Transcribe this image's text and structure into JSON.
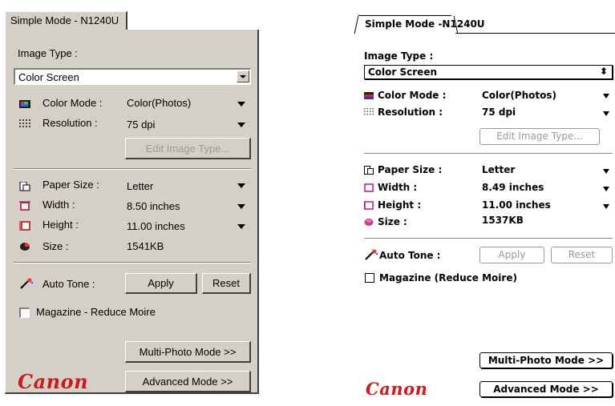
{
  "windows": {
    "tab": "Simple Mode - N1240U",
    "image_type_label": "Image Type :",
    "image_type_value": "Color Screen",
    "color_mode_label": "Color Mode :",
    "color_mode_value": "Color(Photos)",
    "resolution_label": "Resolution :",
    "resolution_value": "75 dpi",
    "edit_image_type": "Edit Image Type...",
    "paper_size_label": "Paper Size :",
    "paper_size_value": "Letter",
    "width_label": "Width :",
    "width_value": "8.50 inches",
    "height_label": "Height :",
    "height_value": "11.00 inches",
    "size_label": "Size :",
    "size_value": "1541KB",
    "auto_tone_label": "Auto Tone :",
    "apply": "Apply",
    "reset": "Reset",
    "magazine": "Magazine - Reduce Moire",
    "multi_photo": "Multi-Photo Mode >>",
    "advanced": "Advanced Mode >>",
    "logo": "Canon"
  },
  "mac": {
    "tab": "Simple Mode -N1240U",
    "image_type_label": "Image Type :",
    "image_type_value": "Color Screen",
    "color_mode_label": "Color Mode :",
    "color_mode_value": "Color(Photos)",
    "resolution_label": "Resolution :",
    "resolution_value": "75 dpi",
    "edit_image_type": "Edit Image Type...",
    "paper_size_label": "Paper Size :",
    "paper_size_value": "Letter",
    "width_label": "Width :",
    "width_value": "8.49 inches",
    "height_label": "Height :",
    "height_value": "11.00 inches",
    "size_label": "Size :",
    "size_value": "1537KB",
    "auto_tone_label": "Auto Tone :",
    "apply": "Apply",
    "reset": "Reset",
    "magazine": "Magazine (Reduce Moire)",
    "multi_photo": "Multi-Photo Mode >>",
    "advanced": "Advanced Mode >>",
    "logo": "Canon"
  },
  "colors": {
    "logo": "#d01a1a",
    "win_face": "#d4d0c8"
  },
  "icons": [
    "color-mode-icon",
    "resolution-icon",
    "paper-size-icon",
    "width-icon",
    "height-icon",
    "size-icon",
    "auto-tone-icon",
    "dropdown-arrow-icon"
  ]
}
